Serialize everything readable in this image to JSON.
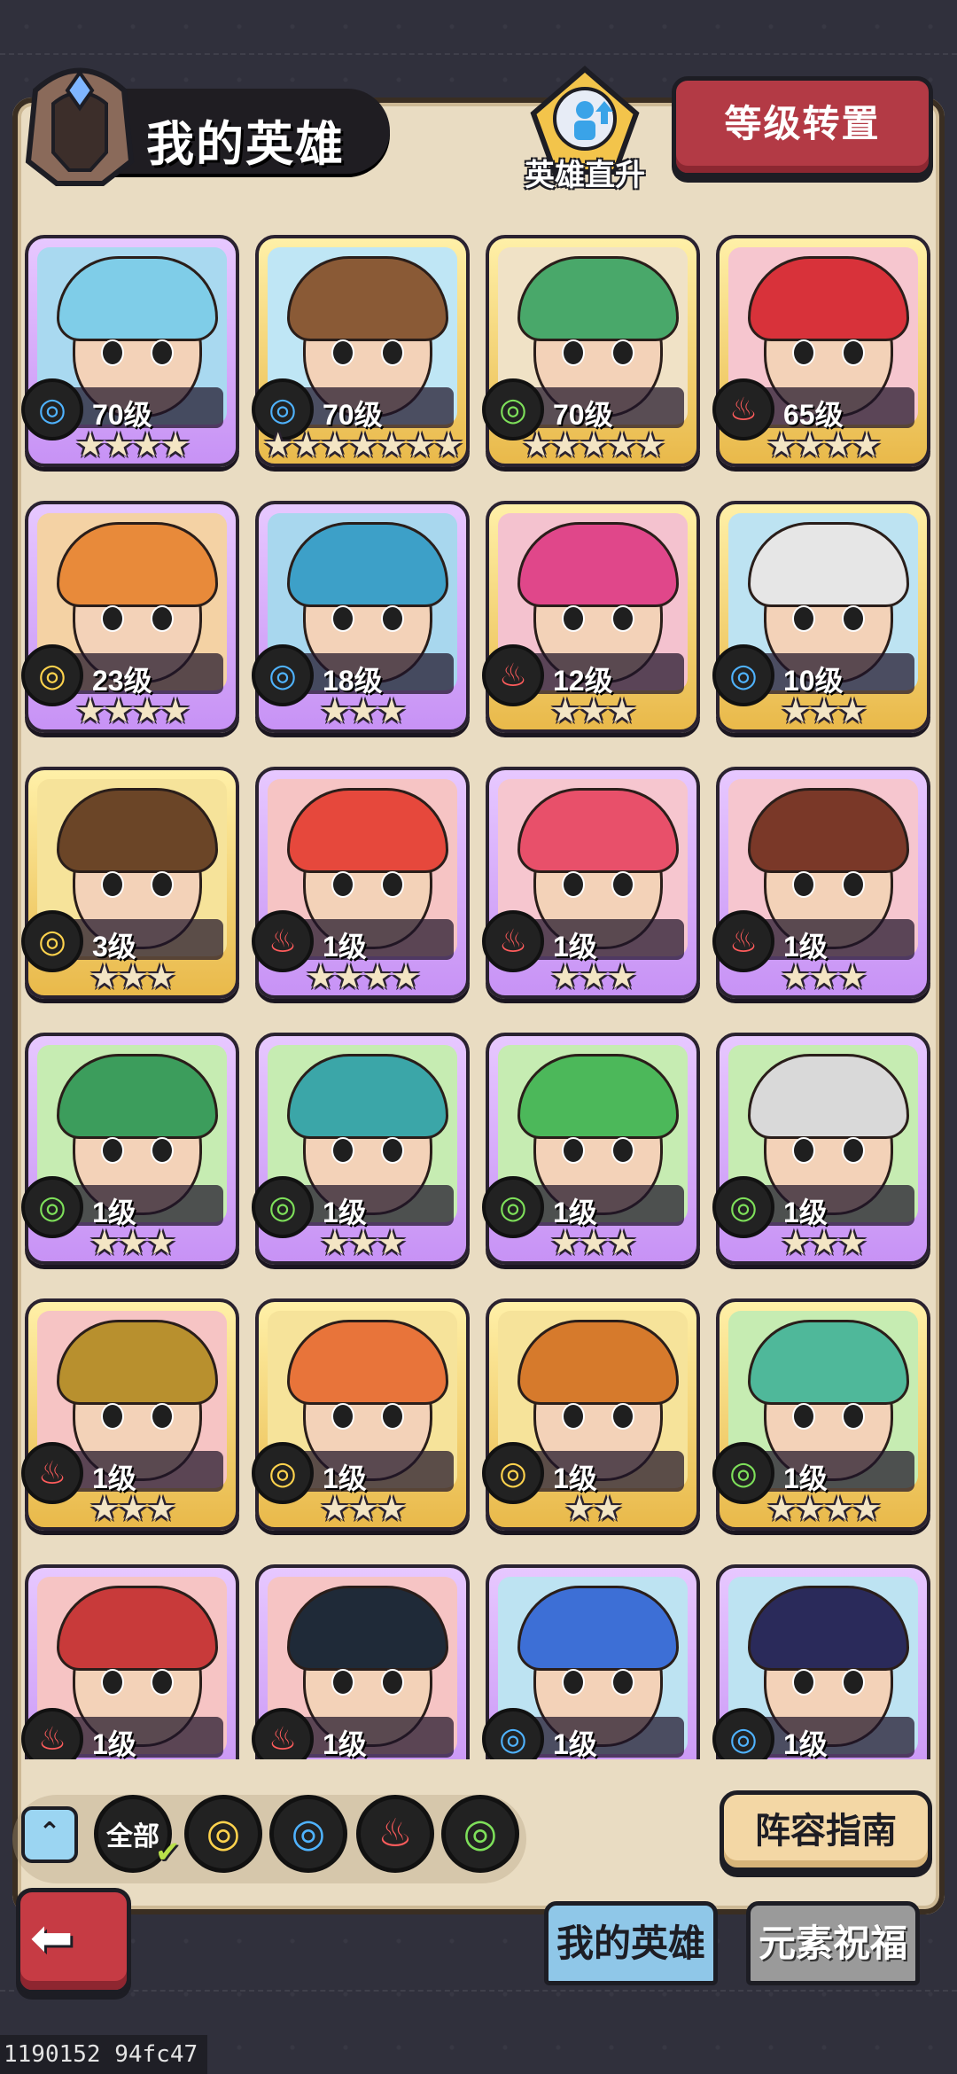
{
  "header": {
    "title": "我的英雄",
    "upgrade_label": "英雄直升",
    "reset_label": "等级转置"
  },
  "elements": {
    "water": {
      "glyph": "◎",
      "color": "#4fb3ff"
    },
    "fire": {
      "glyph": "♨",
      "color": "#ff5c5c"
    },
    "wind": {
      "glyph": "◎",
      "color": "#7ee05a"
    },
    "earth": {
      "glyph": "◎",
      "color": "#ffd34d"
    }
  },
  "heroes": [
    {
      "level": "70级",
      "element": "water",
      "stars": "★★★★",
      "rarity": "purple",
      "hair": "#7fcde8",
      "bg": "#a9d9f0"
    },
    {
      "level": "70级",
      "element": "water",
      "stars": "★★★★★★★",
      "rarity": "gold",
      "hair": "#8a5a36",
      "bg": "#bfe6f5"
    },
    {
      "level": "70级",
      "element": "wind",
      "stars": "★★★★★",
      "rarity": "gold",
      "hair": "#49a86a",
      "bg": "#f0e2c6"
    },
    {
      "level": "65级",
      "element": "fire",
      "stars": "★★★★",
      "rarity": "gold",
      "hair": "#d8323a",
      "bg": "#f6c6cf"
    },
    {
      "level": "23级",
      "element": "earth",
      "stars": "★★★★",
      "rarity": "purple",
      "hair": "#e88a3a",
      "bg": "#f4d2a4"
    },
    {
      "level": "18级",
      "element": "water",
      "stars": "★★★",
      "rarity": "purple",
      "hair": "#3da0c8",
      "bg": "#a8d7ee"
    },
    {
      "level": "12级",
      "element": "fire",
      "stars": "★★★",
      "rarity": "gold",
      "hair": "#e0478a",
      "bg": "#f4c2cf"
    },
    {
      "level": "10级",
      "element": "water",
      "stars": "★★★",
      "rarity": "gold",
      "hair": "#e6e6e6",
      "bg": "#bde3f2"
    },
    {
      "level": "3级",
      "element": "earth",
      "stars": "★★★",
      "rarity": "gold",
      "hair": "#6b4527",
      "bg": "#f6e39a"
    },
    {
      "level": "1级",
      "element": "fire",
      "stars": "★★★★",
      "rarity": "purple",
      "hair": "#e6483c",
      "bg": "#f6c4c4"
    },
    {
      "level": "1级",
      "element": "fire",
      "stars": "★★★",
      "rarity": "purple",
      "hair": "#e8506a",
      "bg": "#f6c6cf"
    },
    {
      "level": "1级",
      "element": "fire",
      "stars": "★★★",
      "rarity": "purple",
      "hair": "#7a3828",
      "bg": "#f6c6cf"
    },
    {
      "level": "1级",
      "element": "wind",
      "stars": "★★★",
      "rarity": "purple",
      "hair": "#3c9d5c",
      "bg": "#c6ecb2"
    },
    {
      "level": "1级",
      "element": "wind",
      "stars": "★★★",
      "rarity": "purple",
      "hair": "#3ba6a8",
      "bg": "#c6ecb2"
    },
    {
      "level": "1级",
      "element": "wind",
      "stars": "★★★",
      "rarity": "purple",
      "hair": "#4cb85a",
      "bg": "#c6ecb2"
    },
    {
      "level": "1级",
      "element": "wind",
      "stars": "★★★",
      "rarity": "purple",
      "hair": "#d9d9d9",
      "bg": "#c6ecb2"
    },
    {
      "level": "1级",
      "element": "fire",
      "stars": "★★★",
      "rarity": "gold",
      "hair": "#b8902e",
      "bg": "#f6c4c4"
    },
    {
      "level": "1级",
      "element": "earth",
      "stars": "★★★",
      "rarity": "gold",
      "hair": "#e8743a",
      "bg": "#f6e39a"
    },
    {
      "level": "1级",
      "element": "earth",
      "stars": "★★",
      "rarity": "gold",
      "hair": "#d67a2c",
      "bg": "#f6e39a"
    },
    {
      "level": "1级",
      "element": "wind",
      "stars": "★★★★",
      "rarity": "gold",
      "hair": "#4fb89a",
      "bg": "#c6ecb2"
    },
    {
      "level": "1级",
      "element": "fire",
      "stars": "★★★",
      "rarity": "purple",
      "hair": "#c83a3a",
      "bg": "#f6c4c4"
    },
    {
      "level": "1级",
      "element": "fire",
      "stars": "★★★",
      "rarity": "purple",
      "hair": "#1f2a38",
      "bg": "#f6c4c4"
    },
    {
      "level": "1级",
      "element": "water",
      "stars": "★★★",
      "rarity": "purple",
      "hair": "#3d6fd6",
      "bg": "#bde3f2"
    },
    {
      "level": "1级",
      "element": "water",
      "stars": "★★★",
      "rarity": "purple",
      "hair": "#2a2a5a",
      "bg": "#bde3f2"
    }
  ],
  "filters": {
    "all_label": "全部",
    "items": [
      "earth",
      "water",
      "fire",
      "wind"
    ]
  },
  "guide_label": "阵容指南",
  "tabs": {
    "my_heroes": "我的英雄",
    "element_blessing": "元素祝福"
  },
  "footer_id": "1190152 94fc47"
}
